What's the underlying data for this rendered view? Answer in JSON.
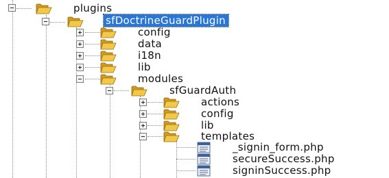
{
  "tree": {
    "nodes": [
      {
        "name": "plugins",
        "type": "folder",
        "expanded": true
      },
      {
        "name": "sfDoctrineGuardPlugin",
        "type": "folder",
        "expanded": true,
        "selected": true
      },
      {
        "name": "config",
        "type": "folder",
        "expanded": false
      },
      {
        "name": "data",
        "type": "folder",
        "expanded": false
      },
      {
        "name": "i18n",
        "type": "folder",
        "expanded": false
      },
      {
        "name": "lib",
        "type": "folder",
        "expanded": false
      },
      {
        "name": "modules",
        "type": "folder",
        "expanded": true
      },
      {
        "name": "sfGuardAuth",
        "type": "folder",
        "expanded": true
      },
      {
        "name": "actions",
        "type": "folder",
        "expanded": false
      },
      {
        "name": "config",
        "type": "folder",
        "expanded": false
      },
      {
        "name": "lib",
        "type": "folder",
        "expanded": false
      },
      {
        "name": "templates",
        "type": "folder",
        "expanded": true
      },
      {
        "name": "_signin_form.php",
        "type": "file"
      },
      {
        "name": "secureSuccess.php",
        "type": "file"
      },
      {
        "name": "signinSuccess.php",
        "type": "file"
      }
    ]
  },
  "colors": {
    "selection": "#2a76d6",
    "folder_body": "#e8b83a",
    "tree_lines": "#8a8a8a"
  },
  "icons": {
    "folder": "folder-icon",
    "file": "php-file-icon",
    "expand": "expand-icon",
    "collapse": "collapse-icon"
  }
}
